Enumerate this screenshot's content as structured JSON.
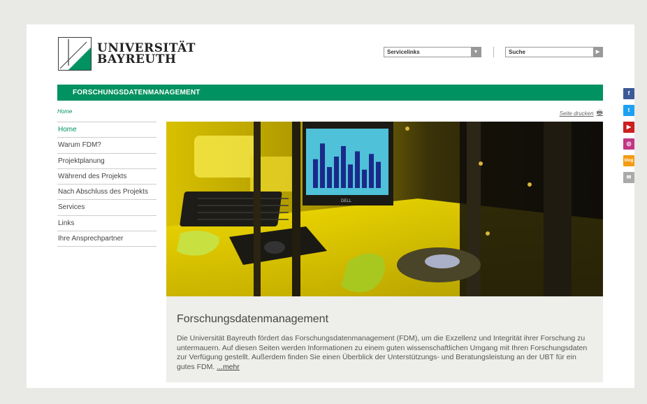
{
  "logo": {
    "line1": "UNIVERSITÄT",
    "line2": "BAYREUTH"
  },
  "header": {
    "service_label": "Servicelinks",
    "search_placeholder": "Suche"
  },
  "banner": {
    "title": "FORSCHUNGSDATENMANAGEMENT"
  },
  "breadcrumb": {
    "home": "Home"
  },
  "print": {
    "label": "Seite drucken"
  },
  "nav": {
    "items": [
      {
        "label": "Home",
        "active": true
      },
      {
        "label": "Warum FDM?"
      },
      {
        "label": "Projektplanung"
      },
      {
        "label": "Während des Projekts"
      },
      {
        "label": "Nach Abschluss des Projekts"
      },
      {
        "label": "Services"
      },
      {
        "label": "Links"
      },
      {
        "label": "Ihre Ansprechpartner"
      }
    ]
  },
  "hero": {
    "monitor_brand": "DELL",
    "image_bars": [
      0.55,
      0.85,
      0.4,
      0.6,
      0.8,
      0.45,
      0.7,
      0.35,
      0.65,
      0.5
    ]
  },
  "content": {
    "title": "Forschungsdatenmanagement",
    "text": "Die Universität Bayreuth fördert das Forschungsdatenmanagement (FDM), um die Exzellenz und Integrität ihrer Forschung zu untermauern. Auf diesen Seiten werden Informationen zu einem guten wissenschaftlichen Umgang mit Ihren Forschungsdaten zur Verfügung gestellt. Außerdem finden Sie einen Überblick der Unterstützungs- und Beratungsleistung an der UBT für ein gutes FDM. ",
    "more": "...mehr"
  },
  "social": {
    "facebook": "f",
    "twitter": "t",
    "youtube": "▶",
    "instagram": "◎",
    "blog": "blog",
    "mail": "✉",
    "colors": {
      "facebook": "#3b5998",
      "twitter": "#1da1f2",
      "youtube": "#cc1f1f",
      "instagram": "#c13584",
      "blog": "#f39c12",
      "mail": "#aaaaaa"
    }
  },
  "colors": {
    "accent": "#009260"
  }
}
